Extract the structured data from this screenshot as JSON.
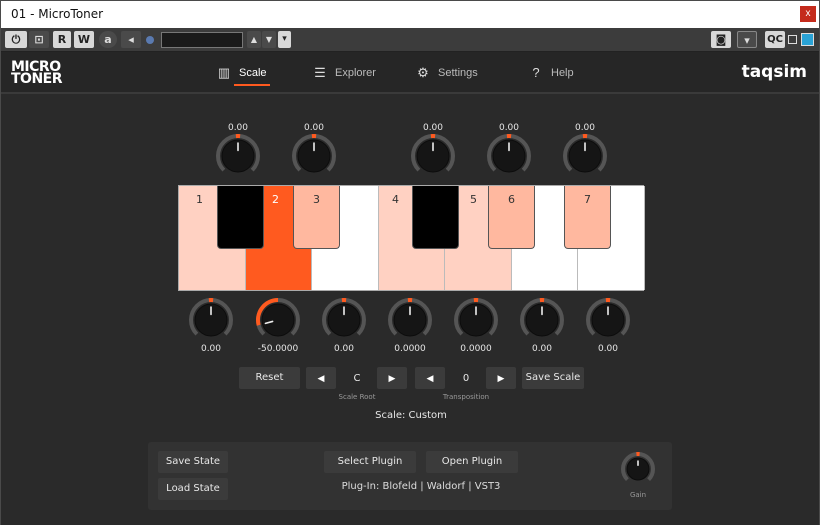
{
  "window": {
    "title": "01 - MicroToner",
    "close_label": "x"
  },
  "host_toolbar": {
    "power_label": "⏻",
    "bypass_label": "⊡",
    "read_label": "R",
    "write_label": "W",
    "auto_label": "a",
    "prev_label": "◂",
    "preset_value": "",
    "up_label": "▲",
    "down_label": "▼",
    "menu_label": "▾",
    "camera_label": "◙",
    "dropdown_label": "▾",
    "qc_label": "QC"
  },
  "header": {
    "logo_line1": "MICRO",
    "logo_line2": "TONER",
    "brand": "taqsim",
    "nav": [
      {
        "label": "Scale",
        "icon": "piano-icon",
        "active": true
      },
      {
        "label": "Explorer",
        "icon": "list-icon",
        "active": false
      },
      {
        "label": "Settings",
        "icon": "gear-icon",
        "active": false
      },
      {
        "label": "Help",
        "icon": "help-icon",
        "active": false
      }
    ]
  },
  "top_knobs": [
    {
      "value": "0.00"
    },
    {
      "value": "0.00"
    },
    {
      "value": "0.00"
    },
    {
      "value": "0.00"
    },
    {
      "value": "0.00"
    }
  ],
  "bottom_knobs": [
    {
      "value": "0.00"
    },
    {
      "value": "-50.0000"
    },
    {
      "value": "0.00"
    },
    {
      "value": "0.0000"
    },
    {
      "value": "0.0000"
    },
    {
      "value": "0.00"
    },
    {
      "value": "0.00"
    }
  ],
  "keyboard": {
    "white_labels": [
      "1",
      "2",
      "",
      "4",
      "5",
      "",
      ""
    ],
    "black_labels": [
      "",
      "3",
      "",
      "6",
      "7"
    ],
    "colors": {
      "selected": "#ff5a1f",
      "tinted": "#ffd1c2",
      "tinted_black": "#ffb89f",
      "black": "#000000",
      "white": "#ffffff"
    }
  },
  "scale_controls": {
    "reset_label": "Reset",
    "root_prev": "◀",
    "root_value": "C",
    "root_next": "▶",
    "root_caption": "Scale Root",
    "trans_prev": "◀",
    "trans_value": "0",
    "trans_next": "▶",
    "trans_caption": "Transposition",
    "save_scale_label": "Save Scale",
    "scale_name": "Scale: Custom"
  },
  "bottom_panel": {
    "save_state_label": "Save State",
    "load_state_label": "Load State",
    "select_plugin_label": "Select Plugin",
    "open_plugin_label": "Open Plugin",
    "plugin_info": "Plug-In: Blofeld | Waldorf | VST3",
    "gain_caption": "Gain"
  },
  "accent_color": "#ff5a1f"
}
